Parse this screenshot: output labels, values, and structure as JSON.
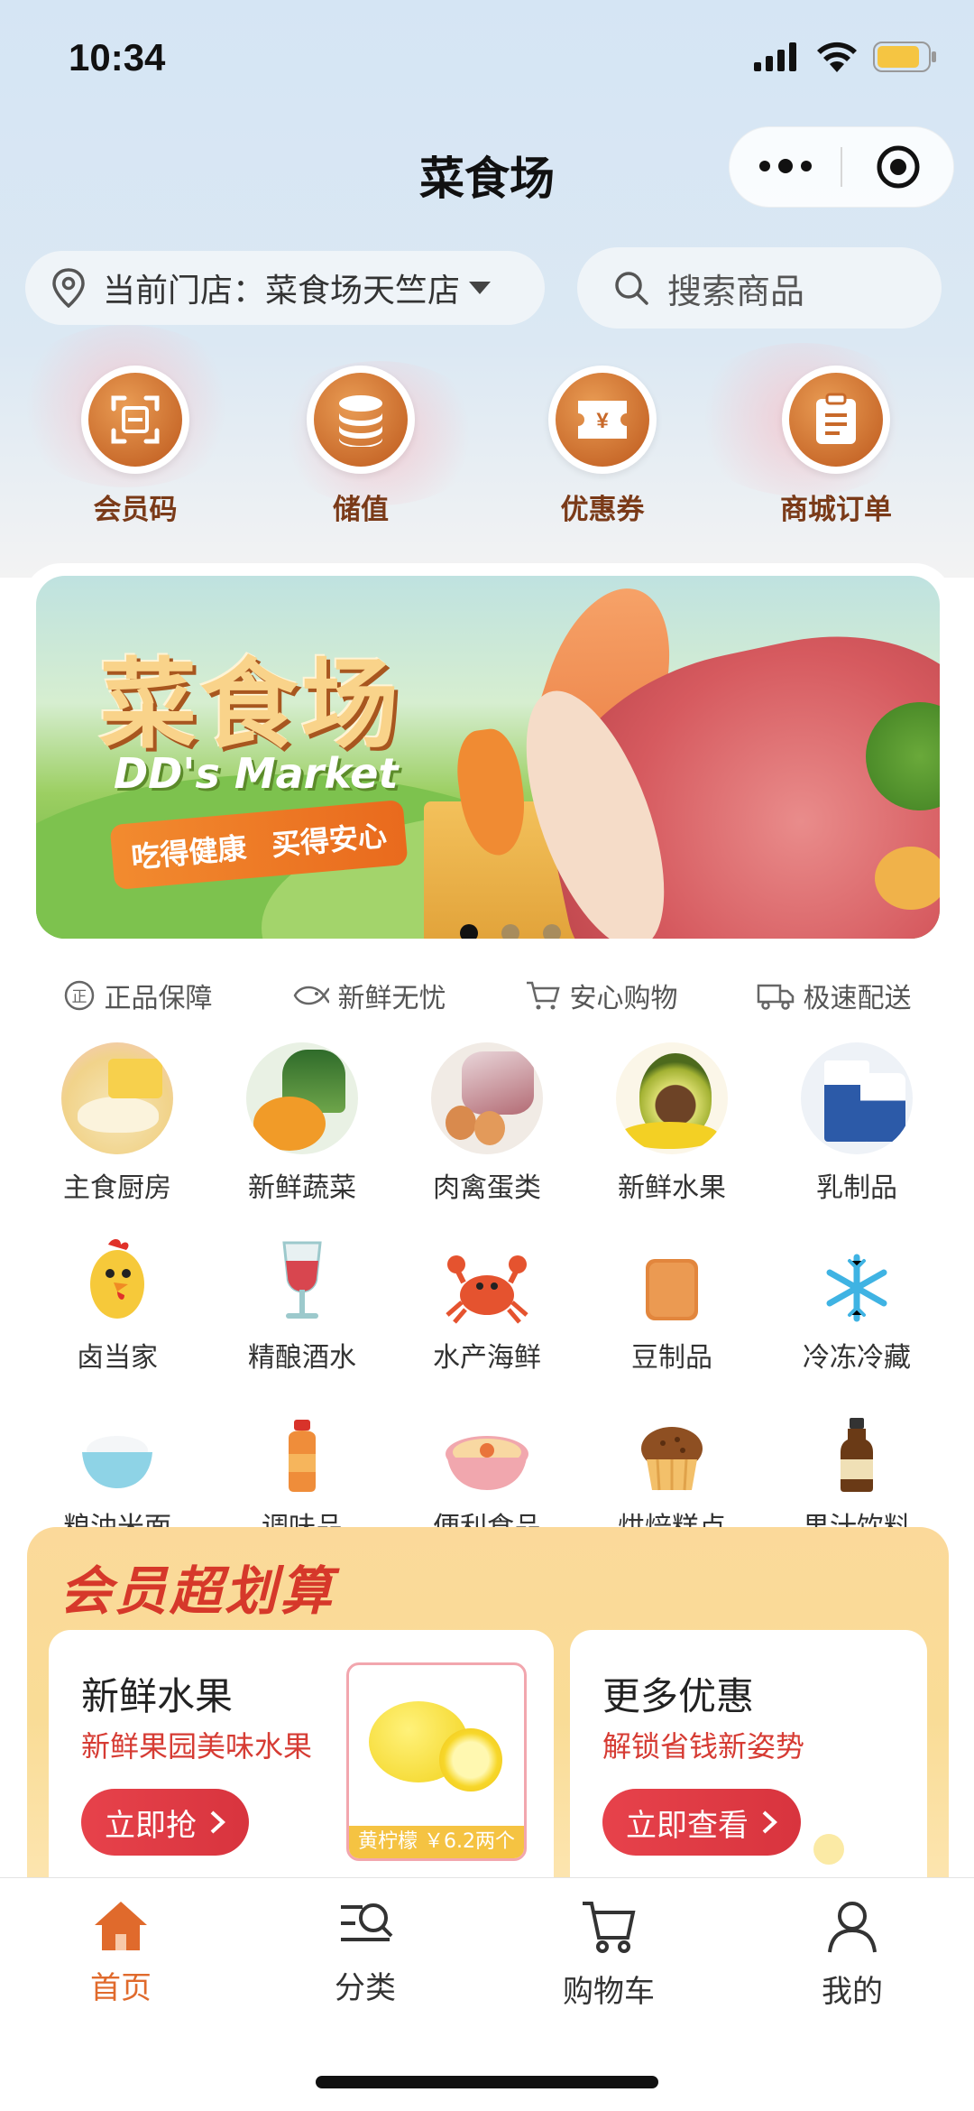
{
  "status_bar": {
    "time": "10:34"
  },
  "header": {
    "title": "菜食场"
  },
  "store_selector": {
    "label": "当前门店：菜食场天竺店"
  },
  "search": {
    "placeholder": "搜索商品"
  },
  "quick_actions": [
    {
      "label": "会员码",
      "icon": "member-code-icon"
    },
    {
      "label": "储值",
      "icon": "coins-icon"
    },
    {
      "label": "优惠券",
      "icon": "coupon-icon"
    },
    {
      "label": "商城订单",
      "icon": "clipboard-icon"
    }
  ],
  "banner": {
    "title": "菜食场",
    "subtitle": "DD's Market",
    "slogan_1": "吃得健康",
    "slogan_2": "买得安心",
    "slides_total": 3,
    "active_slide": 1
  },
  "guarantees": [
    {
      "label": "正品保障",
      "icon": "authentic-icon"
    },
    {
      "label": "新鲜无忧",
      "icon": "fish-icon"
    },
    {
      "label": "安心购物",
      "icon": "cart-icon"
    },
    {
      "label": "极速配送",
      "icon": "truck-icon"
    }
  ],
  "categories": [
    {
      "label": "主食厨房",
      "icon": "dumplings-photo"
    },
    {
      "label": "新鲜蔬菜",
      "icon": "vegetables-photo"
    },
    {
      "label": "肉禽蛋类",
      "icon": "meat-eggs-photo"
    },
    {
      "label": "新鲜水果",
      "icon": "avocado-photo"
    },
    {
      "label": "乳制品",
      "icon": "milk-photo"
    },
    {
      "label": "卤当家",
      "icon": "chicken-icon"
    },
    {
      "label": "精酿酒水",
      "icon": "wine-glass-icon"
    },
    {
      "label": "水产海鲜",
      "icon": "crab-icon"
    },
    {
      "label": "豆制品",
      "icon": "tofu-icon"
    },
    {
      "label": "冷冻冷藏",
      "icon": "snowflake-icon"
    },
    {
      "label": "粮油米面",
      "icon": "rice-bowl-icon"
    },
    {
      "label": "调味品",
      "icon": "sauce-bottle-icon"
    },
    {
      "label": "便利食品",
      "icon": "noodle-bowl-icon"
    },
    {
      "label": "烘焙糕点",
      "icon": "muffin-icon"
    },
    {
      "label": "果汁饮料",
      "icon": "juice-bottle-icon"
    }
  ],
  "member_section": {
    "title": "会员超划算",
    "cards": [
      {
        "title": "新鲜水果",
        "subtitle": "新鲜果园美味水果",
        "button": "立即抢",
        "product_price": "黄柠檬 ￥6.2两个"
      },
      {
        "title": "更多优惠",
        "subtitle": "解锁省钱新姿势",
        "button": "立即查看"
      }
    ]
  },
  "tabbar": [
    {
      "label": "首页",
      "icon": "home-icon",
      "active": true
    },
    {
      "label": "分类",
      "icon": "category-search-icon",
      "active": false
    },
    {
      "label": "购物车",
      "icon": "shopping-cart-icon",
      "active": false
    },
    {
      "label": "我的",
      "icon": "profile-icon",
      "active": false
    }
  ],
  "colors": {
    "accent": "#e06a2c",
    "brand_brown": "#c8692a",
    "promo_red": "#d6382a"
  }
}
